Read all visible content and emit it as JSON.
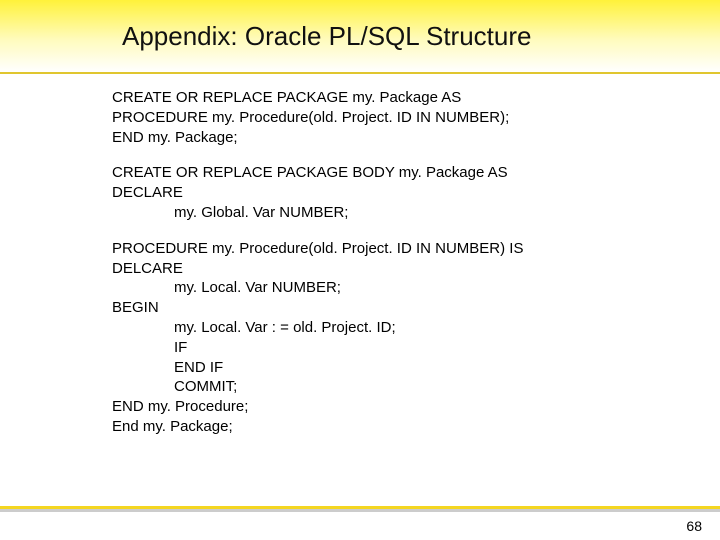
{
  "title": "Appendix: Oracle PL/SQL Structure",
  "page_number": "68",
  "block1": {
    "l1": "CREATE OR REPLACE PACKAGE my. Package AS",
    "l2": "PROCEDURE my. Procedure(old. Project. ID IN NUMBER);",
    "l3": "END my. Package;"
  },
  "block2": {
    "l1": "CREATE OR REPLACE PACKAGE BODY my. Package AS",
    "l2": "DECLARE",
    "l3": "my. Global. Var NUMBER;"
  },
  "block3": {
    "l1": "PROCEDURE my. Procedure(old. Project. ID IN NUMBER) IS",
    "l2": "DELCARE",
    "l3": "my. Local. Var NUMBER;",
    "l4": "BEGIN",
    "l5": "my. Local. Var : = old. Project. ID;",
    "l6": "IF",
    "l7": "END IF",
    "l8": "COMMIT;",
    "l9": "END my. Procedure;",
    "l10": "End my. Package;"
  }
}
